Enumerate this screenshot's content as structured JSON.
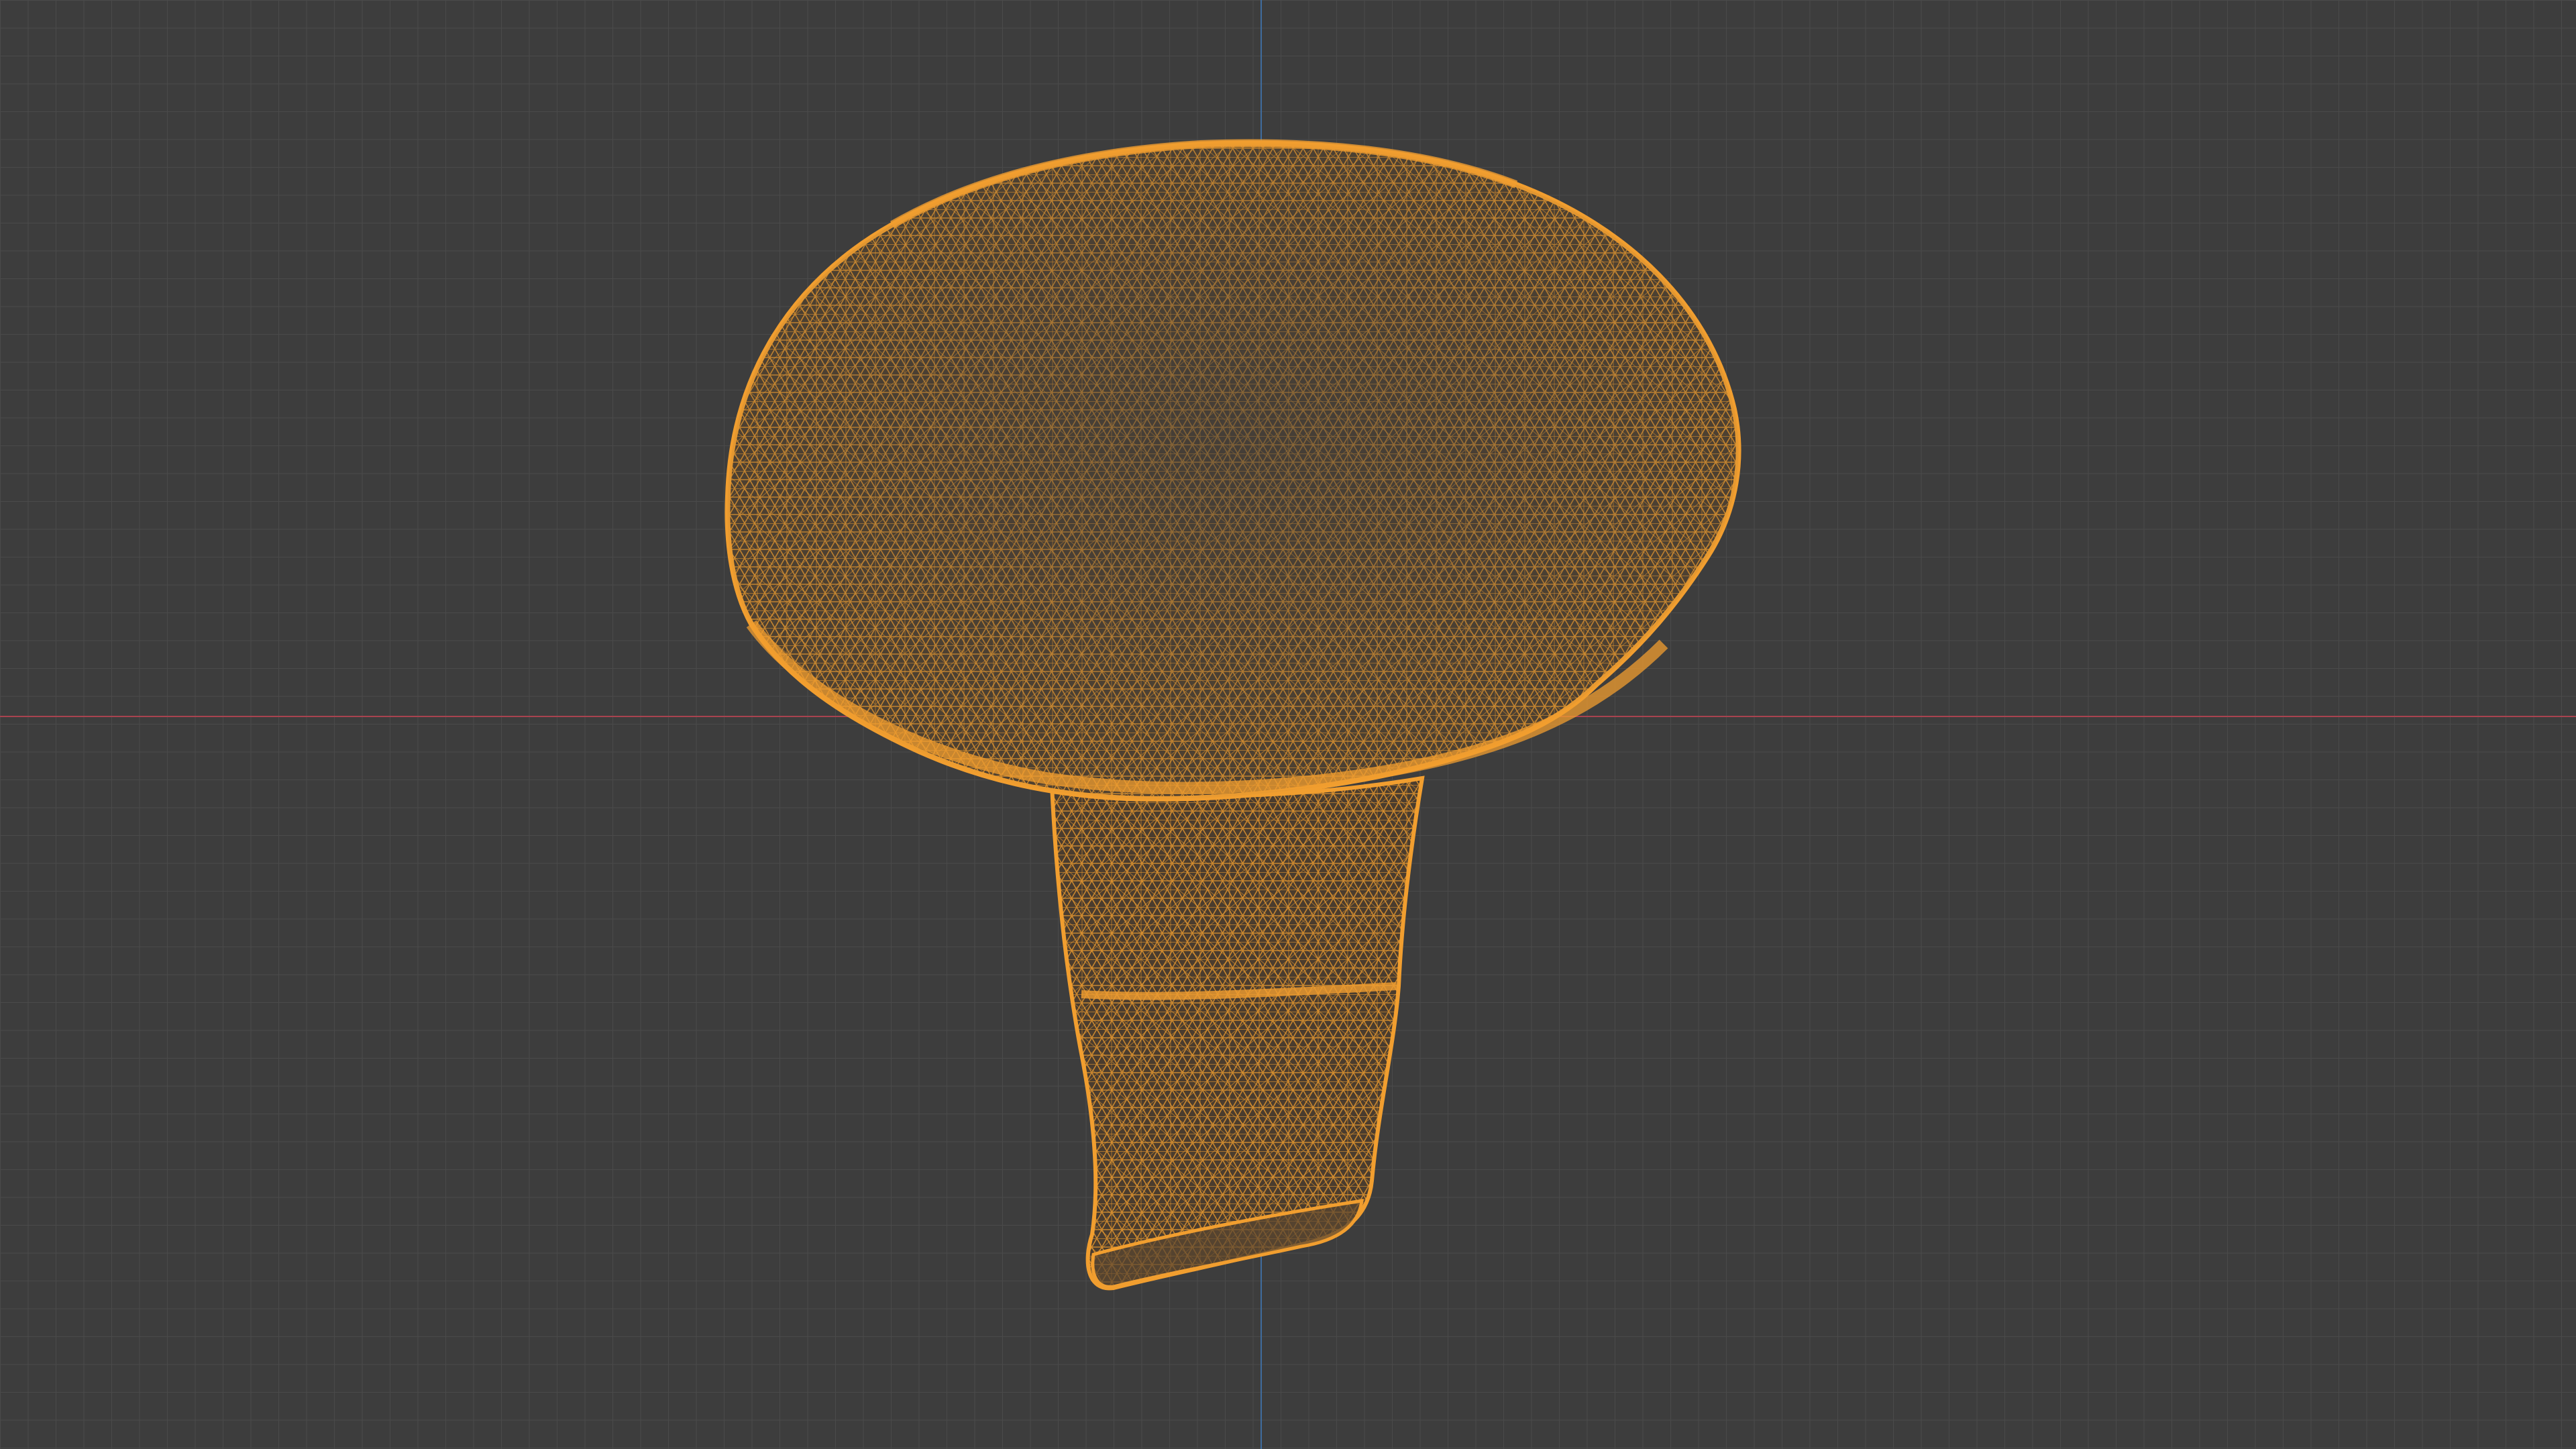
{
  "viewport": {
    "background_color": "#3d3d3d",
    "grid_color": "#4a4a4a",
    "x_axis_color": "#a8434f",
    "y_axis_color": "#3f6d9f",
    "grid_visible": true,
    "shading_mode": "wireframe"
  },
  "object": {
    "name": "mushroom",
    "selected": true,
    "wire_color": "#f19e2f",
    "cap_fill_color": "#4e4030",
    "stem_fill_color": "#4a3c2e"
  }
}
